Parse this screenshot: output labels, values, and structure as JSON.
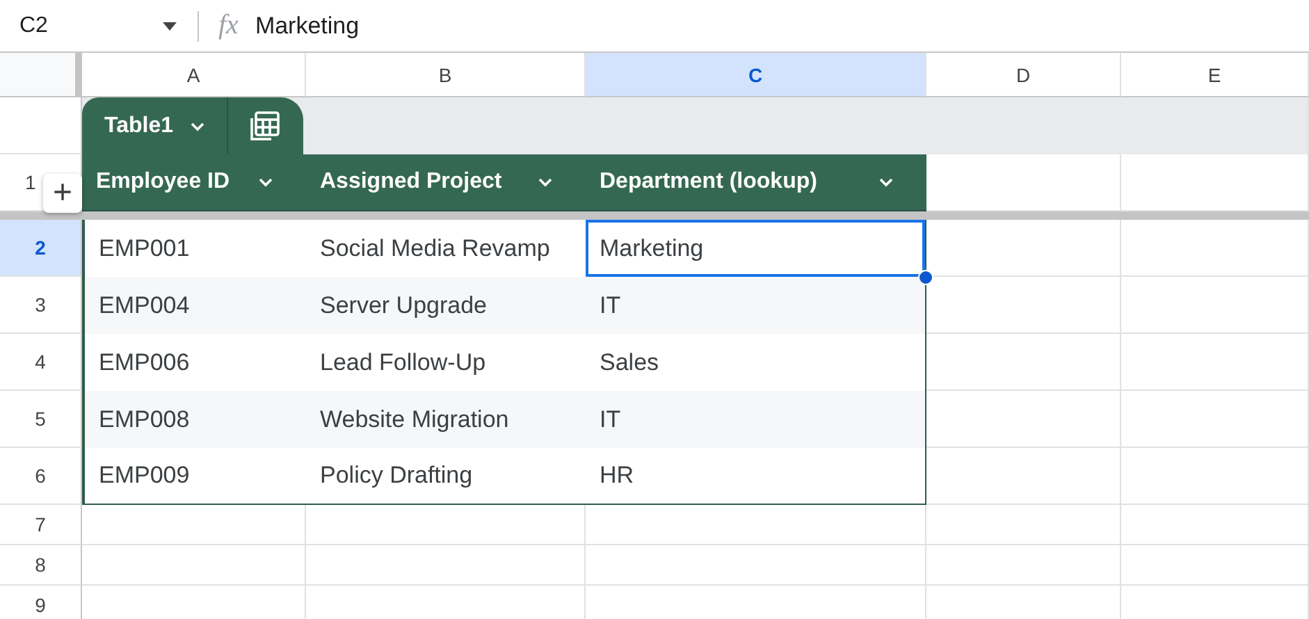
{
  "name_box": {
    "value": "C2"
  },
  "formula_bar": {
    "icon_label": "fx",
    "value": "Marketing"
  },
  "columns": [
    {
      "label": "A",
      "selected": false
    },
    {
      "label": "B",
      "selected": false
    },
    {
      "label": "C",
      "selected": true
    },
    {
      "label": "D",
      "selected": false
    },
    {
      "label": "E",
      "selected": false
    }
  ],
  "table": {
    "name": "Table1",
    "add_button": "+",
    "headers": [
      "Employee ID",
      "Assigned Project",
      "Department (lookup)"
    ],
    "rows": [
      {
        "number": "2",
        "selected": true,
        "cells": [
          {
            "text": "EMP001",
            "selected": false
          },
          {
            "text": "Social Media Revamp",
            "selected": false
          },
          {
            "text": "Marketing",
            "selected": true
          }
        ]
      },
      {
        "number": "3",
        "selected": false,
        "cells": [
          {
            "text": "EMP004",
            "selected": false
          },
          {
            "text": "Server Upgrade",
            "selected": false
          },
          {
            "text": "IT",
            "selected": false
          }
        ]
      },
      {
        "number": "4",
        "selected": false,
        "cells": [
          {
            "text": "EMP006",
            "selected": false
          },
          {
            "text": "Lead Follow-Up",
            "selected": false
          },
          {
            "text": "Sales",
            "selected": false
          }
        ]
      },
      {
        "number": "5",
        "selected": false,
        "cells": [
          {
            "text": "EMP008",
            "selected": false
          },
          {
            "text": "Website Migration",
            "selected": false
          },
          {
            "text": "IT",
            "selected": false
          }
        ]
      },
      {
        "number": "6",
        "selected": false,
        "cells": [
          {
            "text": "EMP009",
            "selected": false
          },
          {
            "text": "Policy Drafting",
            "selected": false
          },
          {
            "text": "HR",
            "selected": false
          }
        ]
      }
    ]
  },
  "header_row_number": "1",
  "empty_rows": [
    "7",
    "8",
    "9"
  ]
}
